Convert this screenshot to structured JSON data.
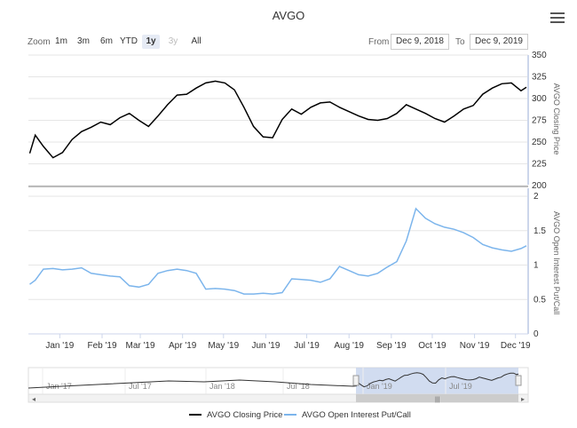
{
  "title": "AVGO",
  "zoom_label": "Zoom",
  "range_buttons": [
    {
      "label": "1m",
      "state": "normal"
    },
    {
      "label": "3m",
      "state": "normal"
    },
    {
      "label": "6m",
      "state": "normal"
    },
    {
      "label": "YTD",
      "state": "normal"
    },
    {
      "label": "1y",
      "state": "active"
    },
    {
      "label": "3y",
      "state": "disabled"
    },
    {
      "label": "All",
      "state": "normal"
    }
  ],
  "from_label": "From",
  "from_value": "Dec 9, 2018",
  "to_label": "To",
  "to_value": "Dec 9, 2019",
  "icons": {
    "menu": "hamburger-menu-icon",
    "navigator_left": "chevron-left-icon",
    "navigator_right": "chevron-right-icon"
  },
  "colors": {
    "closing": "#000000",
    "put_call": "#7cb5ec",
    "navigator_mask": "#c5d3ec"
  },
  "chart_data": [
    {
      "type": "line",
      "name": "AVGO Closing Price",
      "ylabel": "AVGO Closing Price",
      "ylim": [
        200,
        350
      ],
      "yticks": [
        200,
        225,
        250,
        275,
        300,
        325,
        350
      ],
      "x_ticks": [
        "Jan '19",
        "Feb '19",
        "Mar '19",
        "Apr '19",
        "May '19",
        "Jun '19",
        "Jul '19",
        "Aug '19",
        "Sep '19",
        "Oct '19",
        "Nov '19",
        "Dec '19"
      ],
      "x": [
        "2018-12-10",
        "2018-12-14",
        "2018-12-20",
        "2018-12-27",
        "2019-01-03",
        "2019-01-10",
        "2019-01-17",
        "2019-01-24",
        "2019-01-31",
        "2019-02-07",
        "2019-02-14",
        "2019-02-21",
        "2019-02-28",
        "2019-03-07",
        "2019-03-14",
        "2019-03-21",
        "2019-03-28",
        "2019-04-04",
        "2019-04-11",
        "2019-04-18",
        "2019-04-25",
        "2019-05-02",
        "2019-05-09",
        "2019-05-16",
        "2019-05-23",
        "2019-05-30",
        "2019-06-06",
        "2019-06-13",
        "2019-06-20",
        "2019-06-27",
        "2019-07-04",
        "2019-07-11",
        "2019-07-18",
        "2019-07-25",
        "2019-08-01",
        "2019-08-08",
        "2019-08-15",
        "2019-08-22",
        "2019-08-29",
        "2019-09-05",
        "2019-09-12",
        "2019-09-19",
        "2019-09-26",
        "2019-10-03",
        "2019-10-10",
        "2019-10-17",
        "2019-10-24",
        "2019-10-31",
        "2019-11-07",
        "2019-11-14",
        "2019-11-21",
        "2019-11-28",
        "2019-12-05",
        "2019-12-09"
      ],
      "values": [
        237,
        258,
        245,
        232,
        238,
        253,
        262,
        267,
        273,
        270,
        278,
        283,
        275,
        268,
        280,
        293,
        304,
        305,
        312,
        318,
        320,
        318,
        310,
        290,
        268,
        256,
        255,
        276,
        288,
        282,
        290,
        295,
        296,
        290,
        285,
        280,
        276,
        275,
        277,
        283,
        293,
        288,
        283,
        277,
        273,
        280,
        288,
        292,
        305,
        312,
        317,
        318,
        309,
        313
      ]
    },
    {
      "type": "line",
      "name": "AVGO Open Interest Put/Call",
      "ylabel": "AVGO Open Interest Put/Call",
      "ylim": [
        0,
        2
      ],
      "yticks": [
        0,
        0.5,
        1,
        1.5,
        2
      ],
      "x": [
        "2018-12-10",
        "2018-12-14",
        "2018-12-20",
        "2018-12-27",
        "2019-01-03",
        "2019-01-10",
        "2019-01-17",
        "2019-01-24",
        "2019-01-31",
        "2019-02-07",
        "2019-02-14",
        "2019-02-21",
        "2019-02-28",
        "2019-03-07",
        "2019-03-14",
        "2019-03-21",
        "2019-03-28",
        "2019-04-04",
        "2019-04-11",
        "2019-04-18",
        "2019-04-25",
        "2019-05-02",
        "2019-05-09",
        "2019-05-16",
        "2019-05-23",
        "2019-05-30",
        "2019-06-06",
        "2019-06-13",
        "2019-06-20",
        "2019-06-27",
        "2019-07-04",
        "2019-07-11",
        "2019-07-18",
        "2019-07-25",
        "2019-08-01",
        "2019-08-08",
        "2019-08-15",
        "2019-08-22",
        "2019-08-29",
        "2019-09-05",
        "2019-09-12",
        "2019-09-19",
        "2019-09-26",
        "2019-10-03",
        "2019-10-10",
        "2019-10-17",
        "2019-10-24",
        "2019-10-31",
        "2019-11-07",
        "2019-11-14",
        "2019-11-21",
        "2019-11-28",
        "2019-12-05",
        "2019-12-09"
      ],
      "values": [
        0.72,
        0.78,
        0.94,
        0.95,
        0.93,
        0.94,
        0.96,
        0.88,
        0.86,
        0.84,
        0.83,
        0.7,
        0.68,
        0.72,
        0.88,
        0.92,
        0.94,
        0.92,
        0.88,
        0.65,
        0.66,
        0.65,
        0.63,
        0.58,
        0.58,
        0.59,
        0.58,
        0.6,
        0.8,
        0.79,
        0.78,
        0.75,
        0.8,
        0.98,
        0.92,
        0.86,
        0.84,
        0.88,
        0.97,
        1.05,
        1.35,
        1.82,
        1.68,
        1.6,
        1.55,
        1.52,
        1.47,
        1.4,
        1.3,
        1.25,
        1.22,
        1.2,
        1.24,
        1.28
      ]
    }
  ],
  "navigator": {
    "labels": [
      "Jan '17",
      "Jul '17",
      "Jan '18",
      "Jul '18",
      "Jan '19",
      "Jul '19"
    ]
  },
  "legend": [
    {
      "label": "AVGO Closing Price",
      "color": "#000000"
    },
    {
      "label": "AVGO Open Interest Put/Call",
      "color": "#7cb5ec"
    }
  ]
}
